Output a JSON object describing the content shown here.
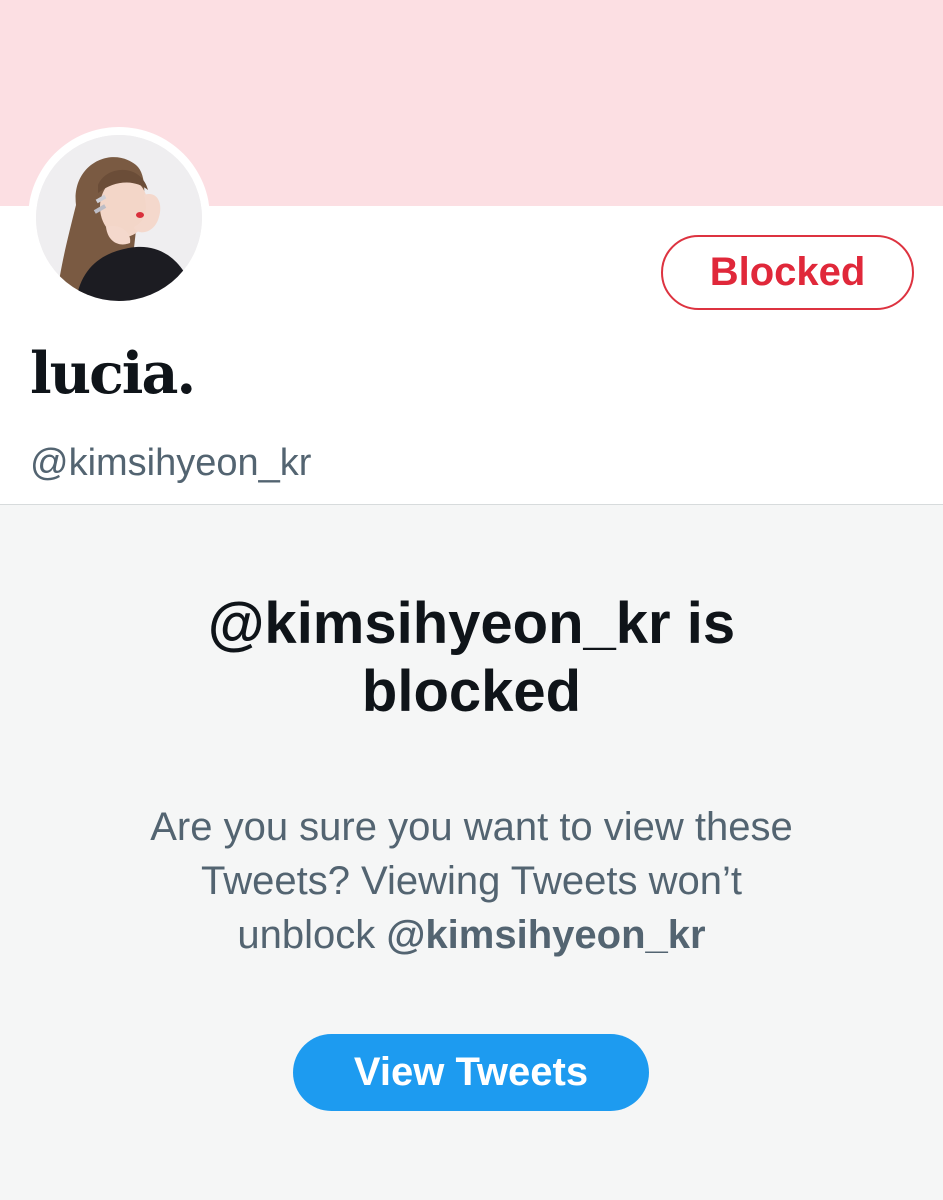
{
  "profile": {
    "display_name": "lucia.",
    "handle": "@kimsihyeon_kr",
    "blocked_label": "Blocked",
    "banner_color": "#fcdfe3"
  },
  "blocked_notice": {
    "title_line1": "@kimsihyeon_kr is",
    "title_line2": "blocked",
    "body_line1": "Are you sure you want to view these",
    "body_line2": "Tweets? Viewing Tweets won’t",
    "body_line3_prefix": "unblock",
    "body_line3_handle": "@kimsihyeon_kr",
    "view_button_label": "View Tweets"
  },
  "colors": {
    "blocked_red": "#e0283a",
    "primary_blue": "#1d9bf0",
    "secondary_text": "#536471",
    "primary_text": "#0f1419"
  }
}
